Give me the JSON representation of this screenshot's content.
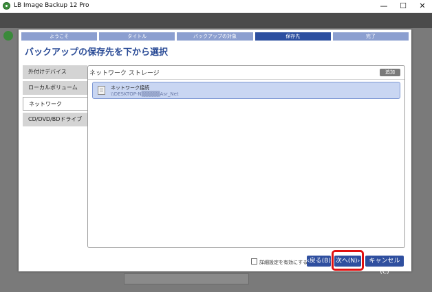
{
  "window": {
    "title": "LB Image Backup 12 Pro",
    "minimize": "—",
    "maximize": "☐",
    "close": "✕"
  },
  "steps": [
    "ようこそ",
    "タイトル",
    "バックアップの対象",
    "保存先",
    "完了"
  ],
  "active_step": 3,
  "heading": "バックアップの保存先を下から選択",
  "left_tabs": [
    "外付けデバイス",
    "ローカルボリューム",
    "ネットワーク",
    "CD/DVD/BDドライブ"
  ],
  "active_tab": 2,
  "panel": {
    "header": "ネットワーク ストレージ",
    "add_label": "追加",
    "item": {
      "name": "ネットワーク接続",
      "path": "\\\\DESKTOP-N▒▒▒▒▒Asr_Net"
    }
  },
  "advanced_checkbox": "詳細設定を有効にする",
  "buttons": {
    "back": "‹戻る(B)",
    "next": "次へ(N)›",
    "cancel": "キャンセル(C)"
  }
}
